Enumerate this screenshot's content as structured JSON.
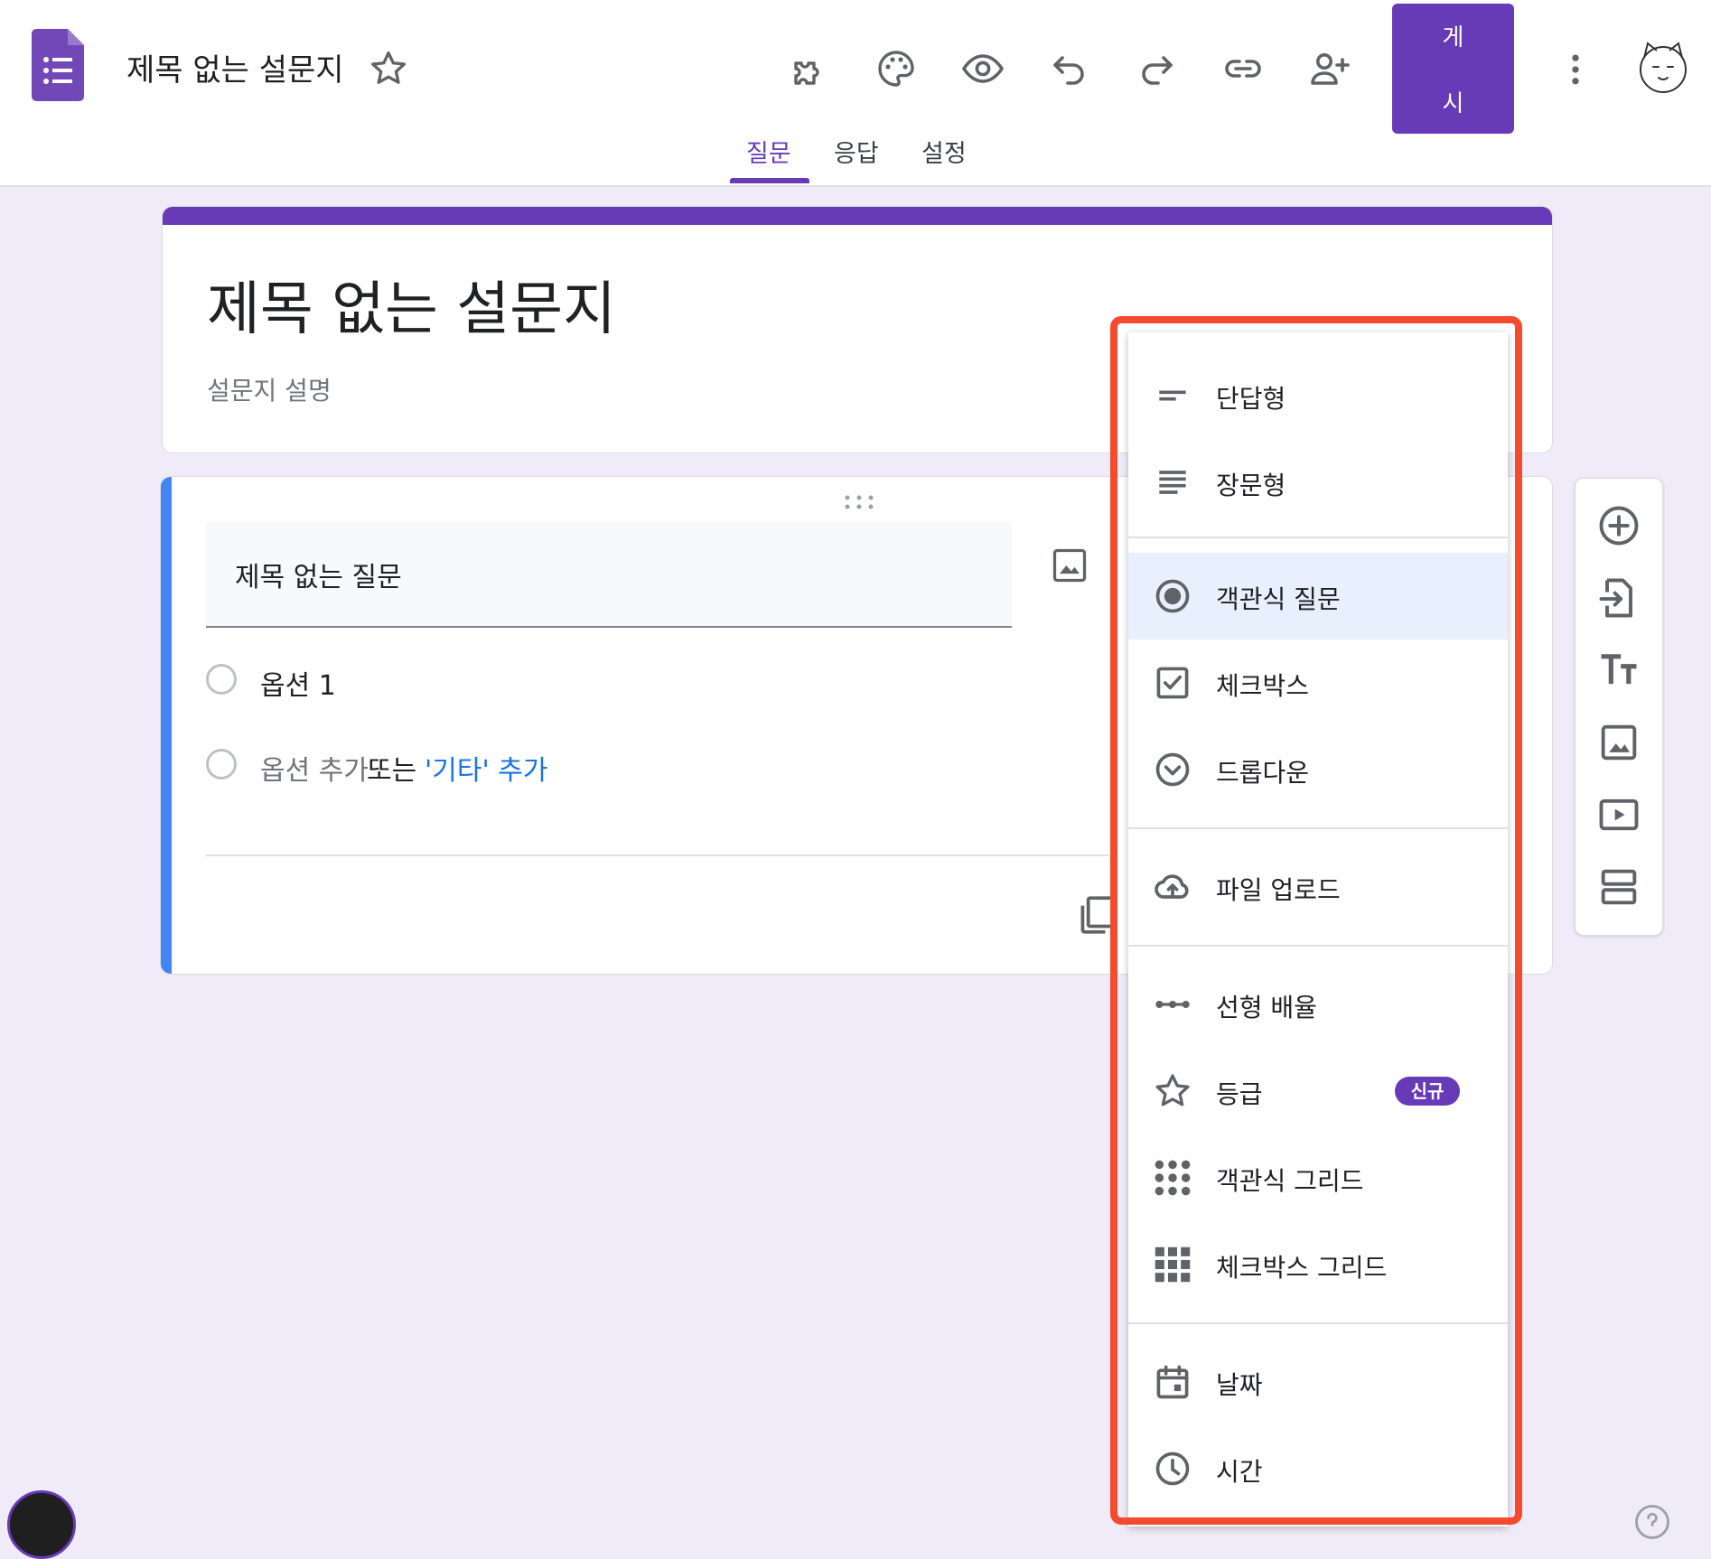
{
  "header": {
    "doc_title": "제목 없는 설문지",
    "publish_label_line1": "게",
    "publish_label_line2": "시",
    "tabs": [
      {
        "label": "질문",
        "active": true
      },
      {
        "label": "응답",
        "active": false
      },
      {
        "label": "설정",
        "active": false
      }
    ],
    "toolbar_icons": [
      "addon-icon",
      "palette-icon",
      "preview-eye-icon",
      "undo-icon",
      "redo-icon",
      "link-icon",
      "add-collaborator-icon"
    ]
  },
  "form": {
    "title": "제목 없는 설문지",
    "description_placeholder": "설문지 설명"
  },
  "question": {
    "title": "제목 없는 질문",
    "option1": "옵션 1",
    "add_option_text": "옵션 추가",
    "or_text": "또는",
    "add_other_link": "'기타' 추가"
  },
  "question_type_menu": {
    "items": [
      {
        "label": "단답형",
        "icon": "short-answer-icon"
      },
      {
        "label": "장문형",
        "icon": "paragraph-icon"
      },
      {
        "label": "객관식 질문",
        "icon": "radio-icon",
        "selected": true
      },
      {
        "label": "체크박스",
        "icon": "checkbox-icon"
      },
      {
        "label": "드롭다운",
        "icon": "dropdown-icon"
      },
      {
        "label": "파일 업로드",
        "icon": "cloud-upload-icon"
      },
      {
        "label": "선형 배율",
        "icon": "linear-scale-icon"
      },
      {
        "label": "등급",
        "icon": "star-icon",
        "badge": "신규"
      },
      {
        "label": "객관식 그리드",
        "icon": "radio-grid-icon"
      },
      {
        "label": "체크박스 그리드",
        "icon": "checkbox-grid-icon"
      },
      {
        "label": "날짜",
        "icon": "calendar-icon"
      },
      {
        "label": "시간",
        "icon": "clock-icon"
      }
    ]
  },
  "side_toolbar": [
    "add-question-icon",
    "import-questions-icon",
    "add-title-icon",
    "add-image-icon",
    "add-video-icon",
    "add-section-icon"
  ],
  "colors": {
    "brand": "#673ab7",
    "background": "#f0ebf8",
    "question_accent": "#4285f4",
    "highlight": "#f44a2d",
    "selected_item": "#e8f0fe",
    "link": "#1a73e8"
  }
}
